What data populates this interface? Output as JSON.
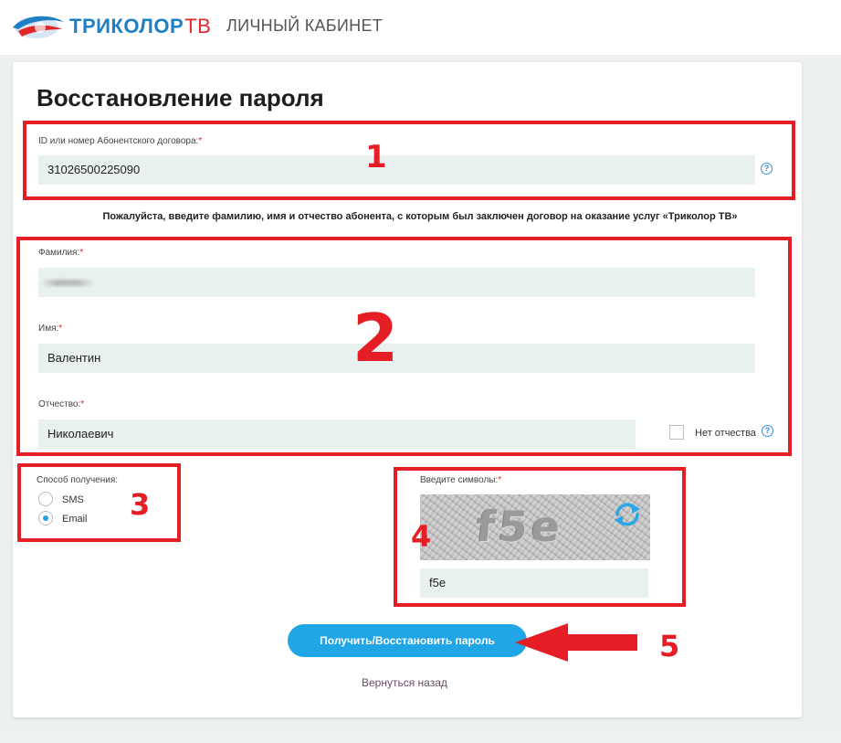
{
  "header": {
    "logo_text": "ТРИКОЛОР",
    "logo_suffix": "ТВ",
    "title": "ЛИЧНЫЙ КАБИНЕТ"
  },
  "form": {
    "page_title": "Восстановление пароля",
    "id_label": "ID или номер Абонентского договора:",
    "id_value": "31026500225090",
    "notice": "Пожалуйста, введите фамилию, имя и отчество абонента, с которым был заключен договор на оказание услуг «Триколор ТВ»",
    "surname_label": "Фамилия:",
    "surname_value": "",
    "name_label": "Имя:",
    "name_value": "Валентин",
    "patronymic_label": "Отчество:",
    "patronymic_value": "Николаевич",
    "no_patronymic_label": "Нет отчества",
    "method_label": "Способ получения:",
    "method_options": [
      "SMS",
      "Email"
    ],
    "method_selected": "Email",
    "captcha_label": "Введите символы:",
    "captcha_image_text": "f5e",
    "captcha_value": "f5e",
    "submit_label": "Получить/Восстановить пароль",
    "back_label": "Вернуться назад",
    "required_mark": "*",
    "help_glyph": "?"
  },
  "annotations": [
    "1",
    "2",
    "3",
    "4",
    "5"
  ],
  "colors": {
    "brand_blue": "#1f7fc4",
    "brand_red": "#e3262a",
    "button": "#20a5e6",
    "annotation_red": "#e51d25",
    "field_bg": "#e9f0f0"
  },
  "icons": {
    "logo": "tricolor-logo-icon",
    "help": "help-icon",
    "refresh": "refresh-icon"
  }
}
